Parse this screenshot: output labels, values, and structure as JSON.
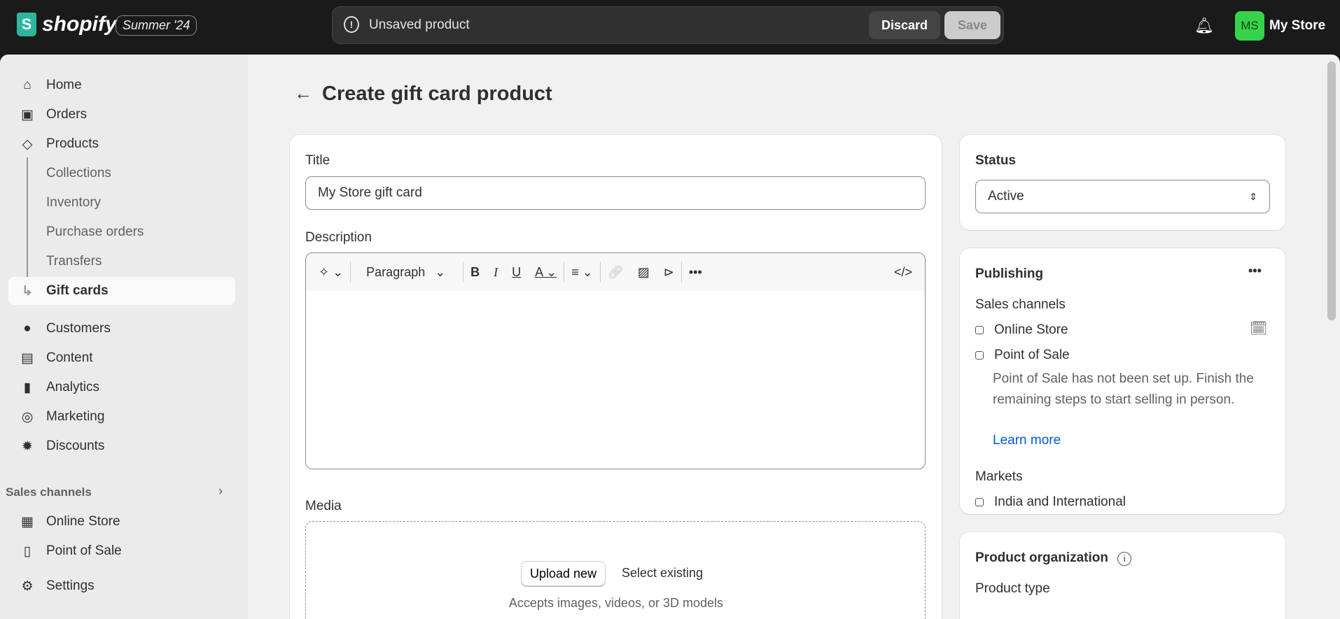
{
  "topbar": {
    "brand": "shopify",
    "edition": "Summer '24",
    "unsaved_message": "Unsaved product",
    "discard": "Discard",
    "save": "Save",
    "avatar_initials": "MS",
    "store_name": "My Store"
  },
  "sidebar": {
    "items": [
      {
        "label": "Home",
        "icon": "home-icon"
      },
      {
        "label": "Orders",
        "icon": "inbox-icon"
      },
      {
        "label": "Products",
        "icon": "tag-icon"
      },
      {
        "label": "Collections"
      },
      {
        "label": "Inventory"
      },
      {
        "label": "Purchase orders"
      },
      {
        "label": "Transfers"
      },
      {
        "label": "Gift cards"
      },
      {
        "label": "Customers",
        "icon": "person-icon"
      },
      {
        "label": "Content",
        "icon": "image-icon"
      },
      {
        "label": "Analytics",
        "icon": "bar-chart-icon"
      },
      {
        "label": "Marketing",
        "icon": "target-icon"
      },
      {
        "label": "Discounts",
        "icon": "discount-icon"
      }
    ],
    "sales_channels_label": "Sales channels",
    "channels": [
      {
        "label": "Online Store"
      },
      {
        "label": "Point of Sale"
      }
    ],
    "settings": "Settings"
  },
  "page": {
    "title": "Create gift card product"
  },
  "main": {
    "title_label": "Title",
    "title_value": "My Store gift card",
    "description_label": "Description",
    "toolbar": {
      "format": "Paragraph"
    },
    "media_label": "Media",
    "upload_new": "Upload new",
    "select_existing": "Select existing",
    "media_hint": "Accepts images, videos, or 3D models"
  },
  "status": {
    "heading": "Status",
    "value": "Active"
  },
  "publishing": {
    "heading": "Publishing",
    "sales_channels": "Sales channels",
    "online_store": "Online Store",
    "pos": "Point of Sale",
    "pos_note": "Point of Sale has not been set up. Finish the remaining steps to start selling in person.",
    "learn_more": "Learn more",
    "markets": "Markets",
    "market": "India and International"
  },
  "organization": {
    "heading": "Product organization",
    "product_type": "Product type"
  },
  "colors": {
    "accent": "#005bd3",
    "avatar": "#36d34a",
    "topbar": "#1a1a1a"
  }
}
